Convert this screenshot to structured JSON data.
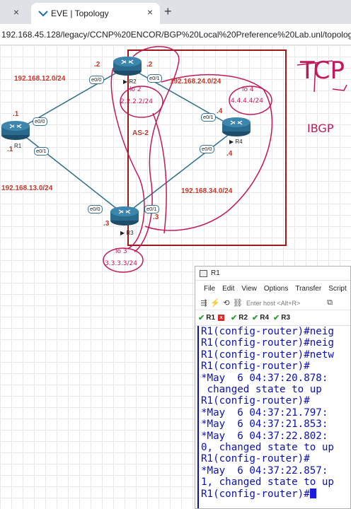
{
  "browser": {
    "tab_title": "EVE | Topology",
    "tab_close": "×",
    "left_close": "×",
    "new_tab": "+",
    "url": "192.168.45.128/legacy/CCNP%20ENCOR/BGP%20Local%20Preference%20Lab.unl/topology"
  },
  "topology": {
    "nets": {
      "r1r2": "192.168.12.0/24",
      "r1r3": "192.168.13.0/24",
      "r2r4": "192.168.24.0/24",
      "r3r4": "192.168.34.0/24"
    },
    "nodes": {
      "r1": {
        "name": "R1",
        "dot": ".1",
        "dot2": ".1"
      },
      "r2": {
        "name": "R2",
        "dot": ".2",
        "dot2": ".2"
      },
      "r3": {
        "name": "R3",
        "dot": ".3",
        "dot2": ".3"
      },
      "r4": {
        "name": "R4",
        "dot": ".4",
        "dot2": ".4"
      }
    },
    "ports": {
      "r1_e00": "e0/0",
      "r1_e01": "e0/1",
      "r2_e00": "e0/0",
      "r2_e01": "e0/1",
      "r3_e00": "e0/0",
      "r3_e01": "e0/1",
      "r4_e01": "e0/1",
      "r4_e00": "e0/0"
    },
    "as_label": "AS-2"
  },
  "annotations": {
    "lo2_name": "lo 2",
    "lo2_addr": "2.2.2.2/24",
    "lo4_name": "lo 4",
    "lo4_addr": "4.4.4.4/24",
    "lo3_name": "lo 3",
    "lo3_addr": "3.3.3.3/24",
    "tcp": "TCP",
    "ibgp": "IBGP"
  },
  "terminal": {
    "title": "R1",
    "menu": [
      "File",
      "Edit",
      "View",
      "Options",
      "Transfer",
      "Script"
    ],
    "host_placeholder": "Enter host <Alt+R>",
    "sessions": [
      "R1",
      "R2",
      "R4",
      "R3"
    ],
    "lines": [
      "R1(config-router)#neig",
      "R1(config-router)#neig",
      "R1(config-router)#netw",
      "R1(config-router)#",
      "*May  6 04:37:20.878:",
      " changed state to up",
      "R1(config-router)#",
      "*May  6 04:37:21.797:",
      "*May  6 04:37:21.853:",
      "*May  6 04:37:22.802:",
      "0, changed state to up",
      "R1(config-router)#",
      "*May  6 04:37:22.857:",
      "1, changed state to up"
    ],
    "prompt": "R1(config-router)#"
  },
  "colors": {
    "ink": "#c2185b",
    "link": "#2c6e8a",
    "net_label": "#c0392b",
    "terminal_text": "#0b10b4"
  }
}
